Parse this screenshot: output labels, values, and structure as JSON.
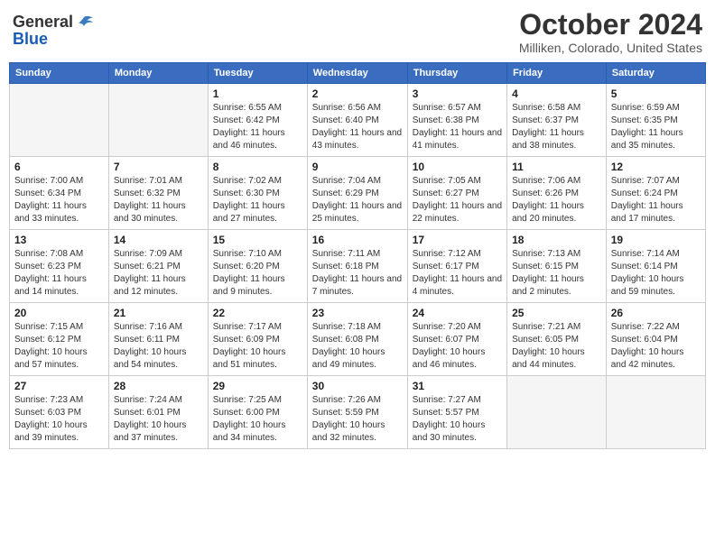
{
  "header": {
    "logo_line1": "General",
    "logo_line2": "Blue",
    "title": "October 2024",
    "subtitle": "Milliken, Colorado, United States"
  },
  "weekdays": [
    "Sunday",
    "Monday",
    "Tuesday",
    "Wednesday",
    "Thursday",
    "Friday",
    "Saturday"
  ],
  "weeks": [
    [
      {
        "num": "",
        "info": ""
      },
      {
        "num": "",
        "info": ""
      },
      {
        "num": "1",
        "info": "Sunrise: 6:55 AM\nSunset: 6:42 PM\nDaylight: 11 hours and 46 minutes."
      },
      {
        "num": "2",
        "info": "Sunrise: 6:56 AM\nSunset: 6:40 PM\nDaylight: 11 hours and 43 minutes."
      },
      {
        "num": "3",
        "info": "Sunrise: 6:57 AM\nSunset: 6:38 PM\nDaylight: 11 hours and 41 minutes."
      },
      {
        "num": "4",
        "info": "Sunrise: 6:58 AM\nSunset: 6:37 PM\nDaylight: 11 hours and 38 minutes."
      },
      {
        "num": "5",
        "info": "Sunrise: 6:59 AM\nSunset: 6:35 PM\nDaylight: 11 hours and 35 minutes."
      }
    ],
    [
      {
        "num": "6",
        "info": "Sunrise: 7:00 AM\nSunset: 6:34 PM\nDaylight: 11 hours and 33 minutes."
      },
      {
        "num": "7",
        "info": "Sunrise: 7:01 AM\nSunset: 6:32 PM\nDaylight: 11 hours and 30 minutes."
      },
      {
        "num": "8",
        "info": "Sunrise: 7:02 AM\nSunset: 6:30 PM\nDaylight: 11 hours and 27 minutes."
      },
      {
        "num": "9",
        "info": "Sunrise: 7:04 AM\nSunset: 6:29 PM\nDaylight: 11 hours and 25 minutes."
      },
      {
        "num": "10",
        "info": "Sunrise: 7:05 AM\nSunset: 6:27 PM\nDaylight: 11 hours and 22 minutes."
      },
      {
        "num": "11",
        "info": "Sunrise: 7:06 AM\nSunset: 6:26 PM\nDaylight: 11 hours and 20 minutes."
      },
      {
        "num": "12",
        "info": "Sunrise: 7:07 AM\nSunset: 6:24 PM\nDaylight: 11 hours and 17 minutes."
      }
    ],
    [
      {
        "num": "13",
        "info": "Sunrise: 7:08 AM\nSunset: 6:23 PM\nDaylight: 11 hours and 14 minutes."
      },
      {
        "num": "14",
        "info": "Sunrise: 7:09 AM\nSunset: 6:21 PM\nDaylight: 11 hours and 12 minutes."
      },
      {
        "num": "15",
        "info": "Sunrise: 7:10 AM\nSunset: 6:20 PM\nDaylight: 11 hours and 9 minutes."
      },
      {
        "num": "16",
        "info": "Sunrise: 7:11 AM\nSunset: 6:18 PM\nDaylight: 11 hours and 7 minutes."
      },
      {
        "num": "17",
        "info": "Sunrise: 7:12 AM\nSunset: 6:17 PM\nDaylight: 11 hours and 4 minutes."
      },
      {
        "num": "18",
        "info": "Sunrise: 7:13 AM\nSunset: 6:15 PM\nDaylight: 11 hours and 2 minutes."
      },
      {
        "num": "19",
        "info": "Sunrise: 7:14 AM\nSunset: 6:14 PM\nDaylight: 10 hours and 59 minutes."
      }
    ],
    [
      {
        "num": "20",
        "info": "Sunrise: 7:15 AM\nSunset: 6:12 PM\nDaylight: 10 hours and 57 minutes."
      },
      {
        "num": "21",
        "info": "Sunrise: 7:16 AM\nSunset: 6:11 PM\nDaylight: 10 hours and 54 minutes."
      },
      {
        "num": "22",
        "info": "Sunrise: 7:17 AM\nSunset: 6:09 PM\nDaylight: 10 hours and 51 minutes."
      },
      {
        "num": "23",
        "info": "Sunrise: 7:18 AM\nSunset: 6:08 PM\nDaylight: 10 hours and 49 minutes."
      },
      {
        "num": "24",
        "info": "Sunrise: 7:20 AM\nSunset: 6:07 PM\nDaylight: 10 hours and 46 minutes."
      },
      {
        "num": "25",
        "info": "Sunrise: 7:21 AM\nSunset: 6:05 PM\nDaylight: 10 hours and 44 minutes."
      },
      {
        "num": "26",
        "info": "Sunrise: 7:22 AM\nSunset: 6:04 PM\nDaylight: 10 hours and 42 minutes."
      }
    ],
    [
      {
        "num": "27",
        "info": "Sunrise: 7:23 AM\nSunset: 6:03 PM\nDaylight: 10 hours and 39 minutes."
      },
      {
        "num": "28",
        "info": "Sunrise: 7:24 AM\nSunset: 6:01 PM\nDaylight: 10 hours and 37 minutes."
      },
      {
        "num": "29",
        "info": "Sunrise: 7:25 AM\nSunset: 6:00 PM\nDaylight: 10 hours and 34 minutes."
      },
      {
        "num": "30",
        "info": "Sunrise: 7:26 AM\nSunset: 5:59 PM\nDaylight: 10 hours and 32 minutes."
      },
      {
        "num": "31",
        "info": "Sunrise: 7:27 AM\nSunset: 5:57 PM\nDaylight: 10 hours and 30 minutes."
      },
      {
        "num": "",
        "info": ""
      },
      {
        "num": "",
        "info": ""
      }
    ]
  ]
}
